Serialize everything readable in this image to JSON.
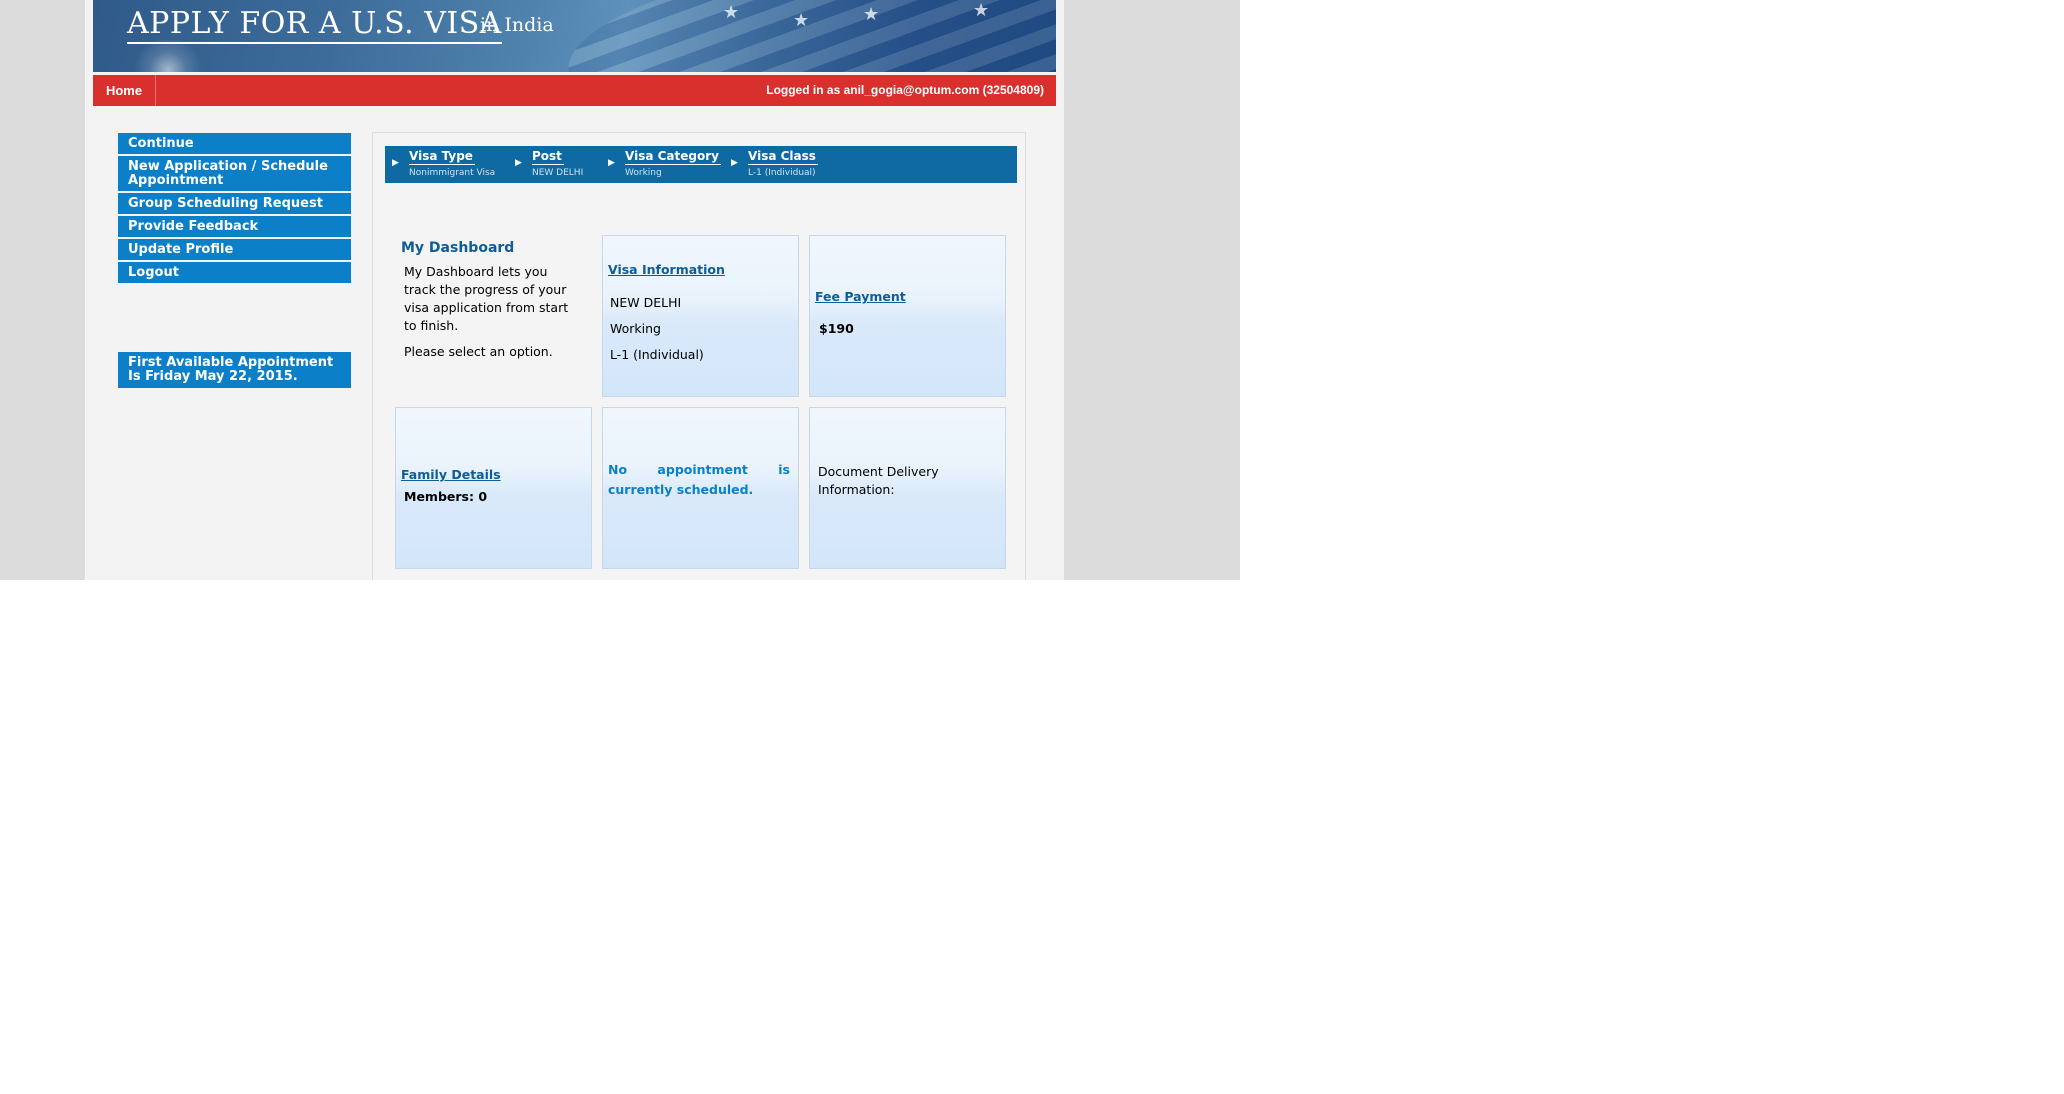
{
  "banner": {
    "title": "APPLY FOR A U.S. VISA",
    "country": "in India"
  },
  "navbar": {
    "home_label": "Home",
    "login_text": "Logged in as  anil_gogia@optum.com (32504809)"
  },
  "sidebar": {
    "items": [
      {
        "label": "Continue"
      },
      {
        "label": "New Application / Schedule Appointment"
      },
      {
        "label": "Group Scheduling Request"
      },
      {
        "label": "Provide Feedback"
      },
      {
        "label": "Update Profile"
      },
      {
        "label": "Logout"
      }
    ],
    "appointment_notice": "First Available Appointment Is Friday May 22, 2015."
  },
  "breadcrumb": {
    "steps": [
      {
        "title": "Visa Type",
        "value": "Nonimmigrant Visa"
      },
      {
        "title": "Post",
        "value": "NEW DELHI"
      },
      {
        "title": "Visa Category",
        "value": "Working"
      },
      {
        "title": "Visa Class",
        "value": "L-1 (Individual)"
      }
    ]
  },
  "dashboard": {
    "title": "My Dashboard",
    "description": "My Dashboard lets you track the progress of your visa application from start to finish.",
    "prompt": "Please select an option.",
    "visa_info": {
      "link": "Visa Information",
      "post": "NEW DELHI",
      "category": "Working",
      "class": "L-1 (Individual)"
    },
    "fee": {
      "link": "Fee Payment",
      "amount": "$190"
    },
    "family": {
      "link": "Family Details",
      "members": "Members: 0"
    },
    "appointment": {
      "text": "No appointment is currently scheduled."
    },
    "delivery": {
      "text": "Document Delivery Information:"
    }
  },
  "colors": {
    "nav_red": "#d9302e",
    "sidebar_blue": "#0b7fc7",
    "breadcrumb_blue": "#0f6aa3",
    "link_blue": "#0e5d95"
  }
}
